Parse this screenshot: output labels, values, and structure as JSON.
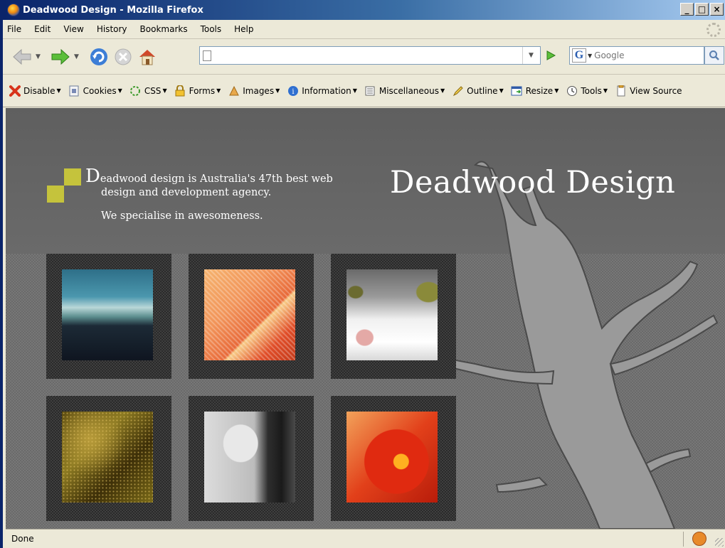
{
  "window": {
    "title": "Deadwood Design - Mozilla Firefox",
    "controls": {
      "minimize": "_",
      "maximize": "□",
      "close": "×"
    }
  },
  "menu": {
    "items": [
      "File",
      "Edit",
      "View",
      "History",
      "Bookmarks",
      "Tools",
      "Help"
    ]
  },
  "navigation": {
    "url_value": "",
    "search_engine": "G",
    "search_placeholder": "Google"
  },
  "webdev_toolbar": {
    "items": [
      {
        "label": "Disable",
        "icon": "disable-icon"
      },
      {
        "label": "Cookies",
        "icon": "cookies-icon"
      },
      {
        "label": "CSS",
        "icon": "css-icon"
      },
      {
        "label": "Forms",
        "icon": "forms-icon"
      },
      {
        "label": "Images",
        "icon": "images-icon"
      },
      {
        "label": "Information",
        "icon": "information-icon"
      },
      {
        "label": "Miscellaneous",
        "icon": "miscellaneous-icon"
      },
      {
        "label": "Outline",
        "icon": "outline-icon"
      },
      {
        "label": "Resize",
        "icon": "resize-icon"
      },
      {
        "label": "Tools",
        "icon": "tools-icon"
      },
      {
        "label": "View Source",
        "icon": "view-source-icon"
      }
    ]
  },
  "page": {
    "intro_drop_cap": "D",
    "intro_line1_rest": "eadwood design is Australia's 47th best web",
    "intro_line2": "design and development agency.",
    "intro_tagline": "We specialise in awesomeness.",
    "site_title": "Deadwood Design",
    "brand_color": "#c5c33c",
    "gallery": [
      {
        "subject": "seaside-silhouette-thumbnail"
      },
      {
        "subject": "orange-fabric-thumbnail"
      },
      {
        "subject": "cat-face-thumbnail"
      },
      {
        "subject": "golden-texture-thumbnail"
      },
      {
        "subject": "smiling-man-bottle-thumbnail"
      },
      {
        "subject": "red-flower-thumbnail"
      }
    ]
  },
  "status": {
    "text": "Done"
  }
}
